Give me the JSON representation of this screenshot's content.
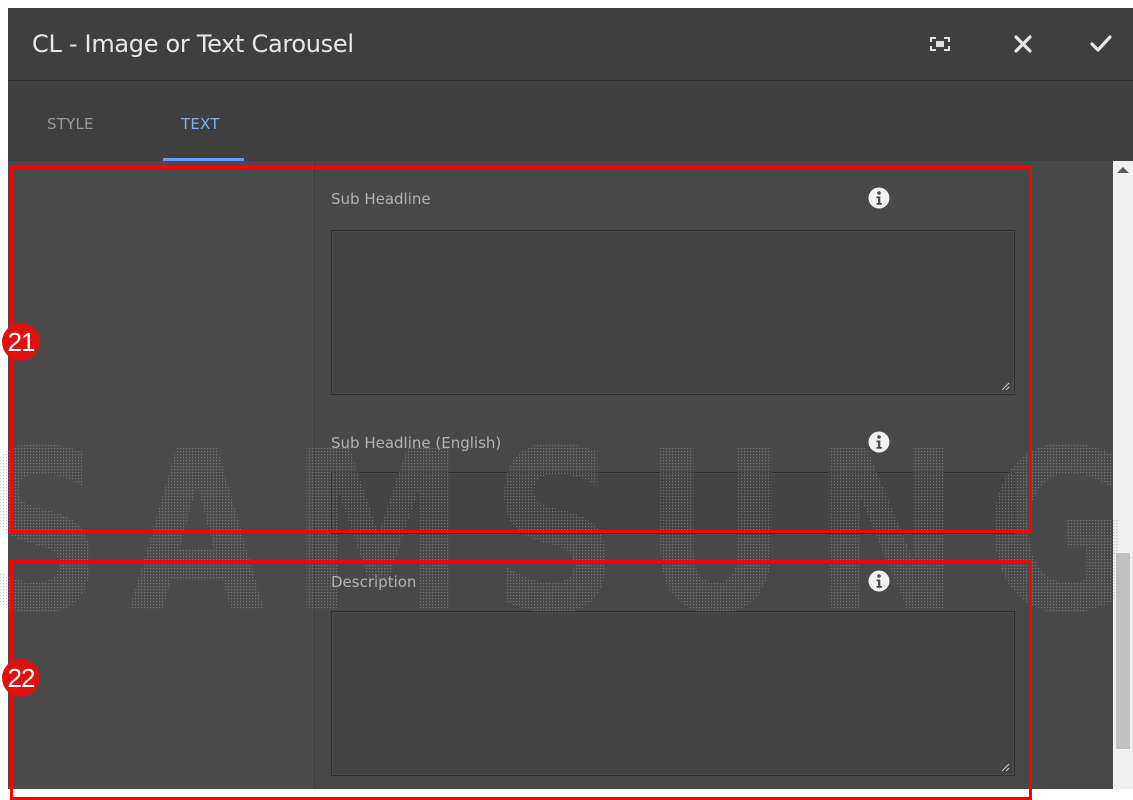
{
  "dialog": {
    "title": "CL - Image or Text Carousel",
    "buttons": {
      "fullscreen_icon": "fullscreen-icon",
      "close_icon": "close-icon",
      "confirm_icon": "checkmark-icon"
    }
  },
  "tabs": [
    {
      "label": "STYLE",
      "active": false
    },
    {
      "label": "TEXT",
      "active": true
    }
  ],
  "fields": [
    {
      "label": "Sub Headline",
      "type": "textarea",
      "value": ""
    },
    {
      "label": "Sub Headline (English)",
      "type": "textarea",
      "value": ""
    },
    {
      "label": "Description",
      "type": "textarea",
      "value": ""
    }
  ],
  "watermark_text": "SAMSUNG",
  "annotations": [
    {
      "number": "21"
    },
    {
      "number": "22"
    }
  ],
  "colors": {
    "dialog_bg": "#484848",
    "titlebar_bg": "#3f3f3f",
    "active_tab": "#72b3ff",
    "annotation": "#ff0000"
  }
}
